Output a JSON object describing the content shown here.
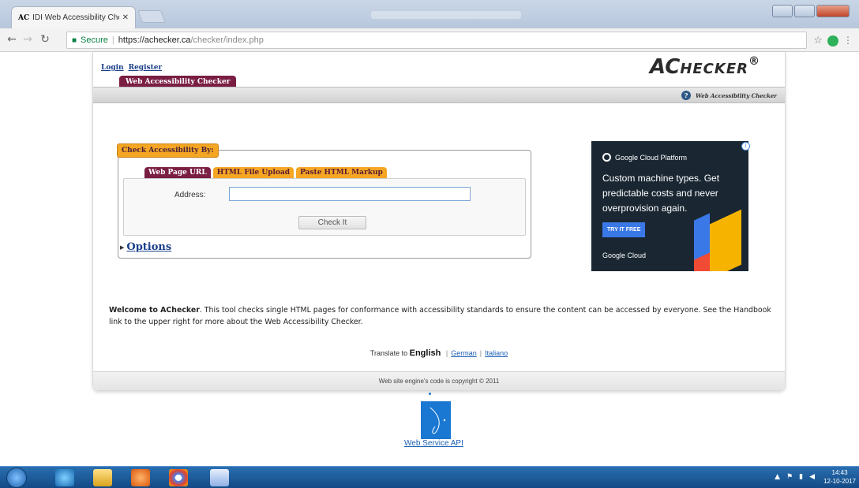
{
  "browser": {
    "tab_title": "IDI Web Accessibility Chec",
    "tab_favicon": "AC",
    "url_secure_label": "Secure",
    "url_host": "https://achecker.ca",
    "url_path": "/checker/index.php"
  },
  "header": {
    "login": "Login",
    "register": "Register",
    "logo_big": "AC",
    "logo_small": "HECKER",
    "logo_reg": "®",
    "nav_tab": "Web Accessibility Checker",
    "handbook_label": "Web Accessibility Checker"
  },
  "checker": {
    "legend": "Check Accessibility By:",
    "tabs": [
      "Web Page URL",
      "HTML File Upload",
      "Paste HTML Markup"
    ],
    "address_label": "Address:",
    "address_value": "",
    "check_button": "Check It",
    "options_label": "Options"
  },
  "ad": {
    "brand": "Google Cloud Platform",
    "text": "Custom machine types. Get predictable costs and never overprovision again.",
    "cta": "TRY IT FREE",
    "footer": "Google Cloud",
    "colors": {
      "bg": "#1a2733",
      "cta": "#3b78e7"
    }
  },
  "welcome": {
    "bold": "Welcome to AChecker",
    "text": ". This tool checks single HTML pages for conformance with accessibility standards to ensure the content can be accessed by everyone. See the Handbook link to the upper right for more about the Web Accessibility Checker."
  },
  "translate": {
    "prefix": "Translate to",
    "current": "English",
    "options": [
      "German",
      "Italiano"
    ]
  },
  "footer": {
    "copyright": "Web site engine's code is copyright © 2011"
  },
  "api": {
    "link": "Web Service API"
  },
  "taskbar": {
    "time": "14:43",
    "date": "12-10-2017"
  },
  "colors": {
    "nav_purple": "#7a1e43",
    "tab_orange": "#f5a623",
    "link_blue": "#1a3f8a"
  }
}
